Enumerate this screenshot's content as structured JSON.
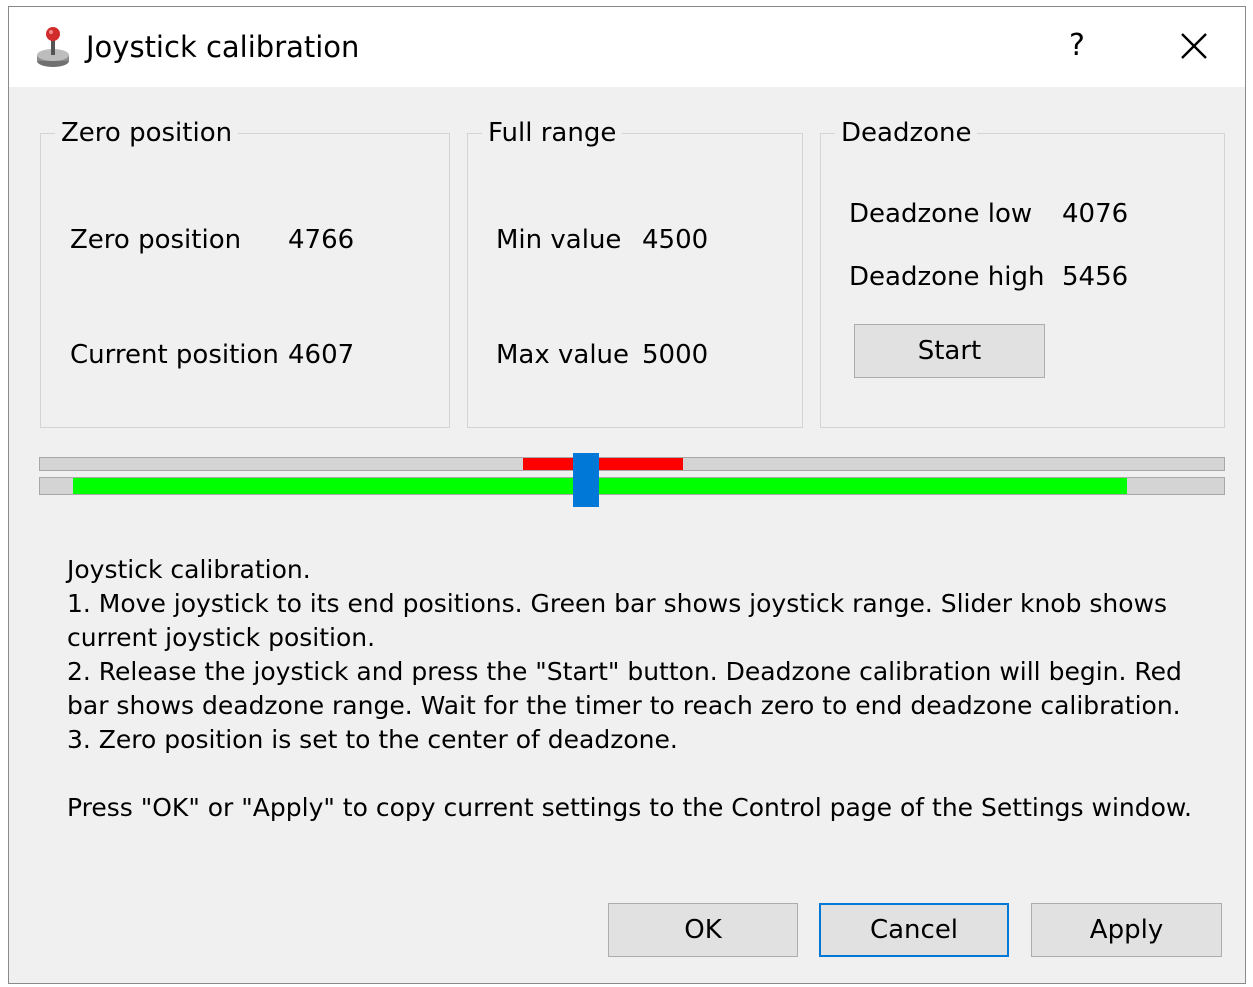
{
  "window": {
    "title": "Joystick calibration",
    "help_label": "?",
    "close_icon": "close-icon",
    "app_icon": "joystick-icon"
  },
  "zero_group": {
    "title": "Zero position",
    "zero_label": "Zero position",
    "zero_value": "4766",
    "current_label": "Current position",
    "current_value": "4607"
  },
  "range_group": {
    "title": "Full range",
    "min_label": "Min value",
    "min_value": "4500",
    "max_label": "Max value",
    "max_value": "5000"
  },
  "deadzone_group": {
    "title": "Deadzone",
    "low_label": "Deadzone low",
    "low_value": "4076",
    "high_label": "Deadzone high",
    "high_value": "5456",
    "start_label": "Start"
  },
  "slider": {
    "range_fraction": [
      0.029,
      0.917
    ],
    "deadzone_fraction": [
      0.408,
      0.543
    ],
    "knob_fraction": 0.461,
    "colors": {
      "range": "#00ff00",
      "deadzone": "#ff0000",
      "knob": "#0078d7"
    }
  },
  "help": {
    "lines": [
      "Joystick calibration.",
      "1. Move joystick to its end positions. Green bar shows joystick range. Slider knob shows current joystick position.",
      "2. Release the joystick and press the \"Start\" button. Deadzone calibration will begin. Red bar shows deadzone range. Wait for the timer to reach zero to end deadzone calibration.",
      "3. Zero position is set to the center of deadzone."
    ],
    "footer": "Press \"OK\" or \"Apply\" to copy current settings to the Control page of the Settings window."
  },
  "buttons": {
    "ok": "OK",
    "cancel": "Cancel",
    "apply": "Apply"
  }
}
